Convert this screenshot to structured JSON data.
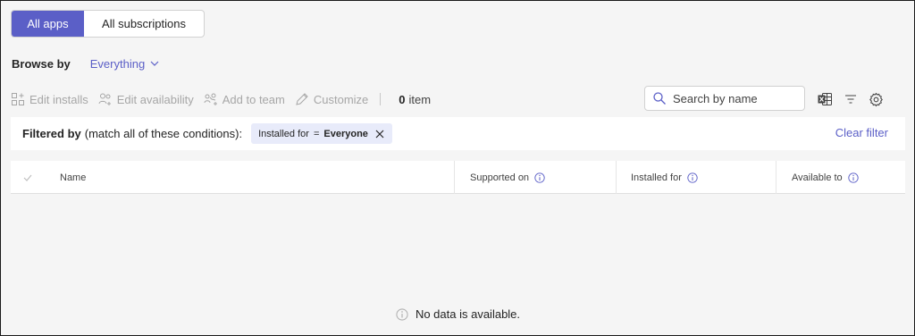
{
  "tabs": [
    {
      "label": "All apps",
      "active": true
    },
    {
      "label": "All subscriptions",
      "active": false
    }
  ],
  "browse": {
    "label": "Browse by",
    "value": "Everything"
  },
  "toolbar": {
    "edit_installs": "Edit installs",
    "edit_availability": "Edit availability",
    "add_to_team": "Add to team",
    "customize": "Customize",
    "count_value": "0",
    "count_unit": "item",
    "search_placeholder": "Search by name"
  },
  "filter": {
    "title": "Filtered by",
    "note": "(match all of these conditions):",
    "chip_field": "Installed for",
    "chip_op": "=",
    "chip_value": "Everyone",
    "clear_label": "Clear filter"
  },
  "table": {
    "columns": [
      "Name",
      "Supported on",
      "Installed for",
      "Available to"
    ],
    "empty_message": "No data is available."
  },
  "colors": {
    "accent": "#5b5fc7",
    "chip_bg": "#e8ebfa",
    "disabled": "#a6a6a6"
  }
}
